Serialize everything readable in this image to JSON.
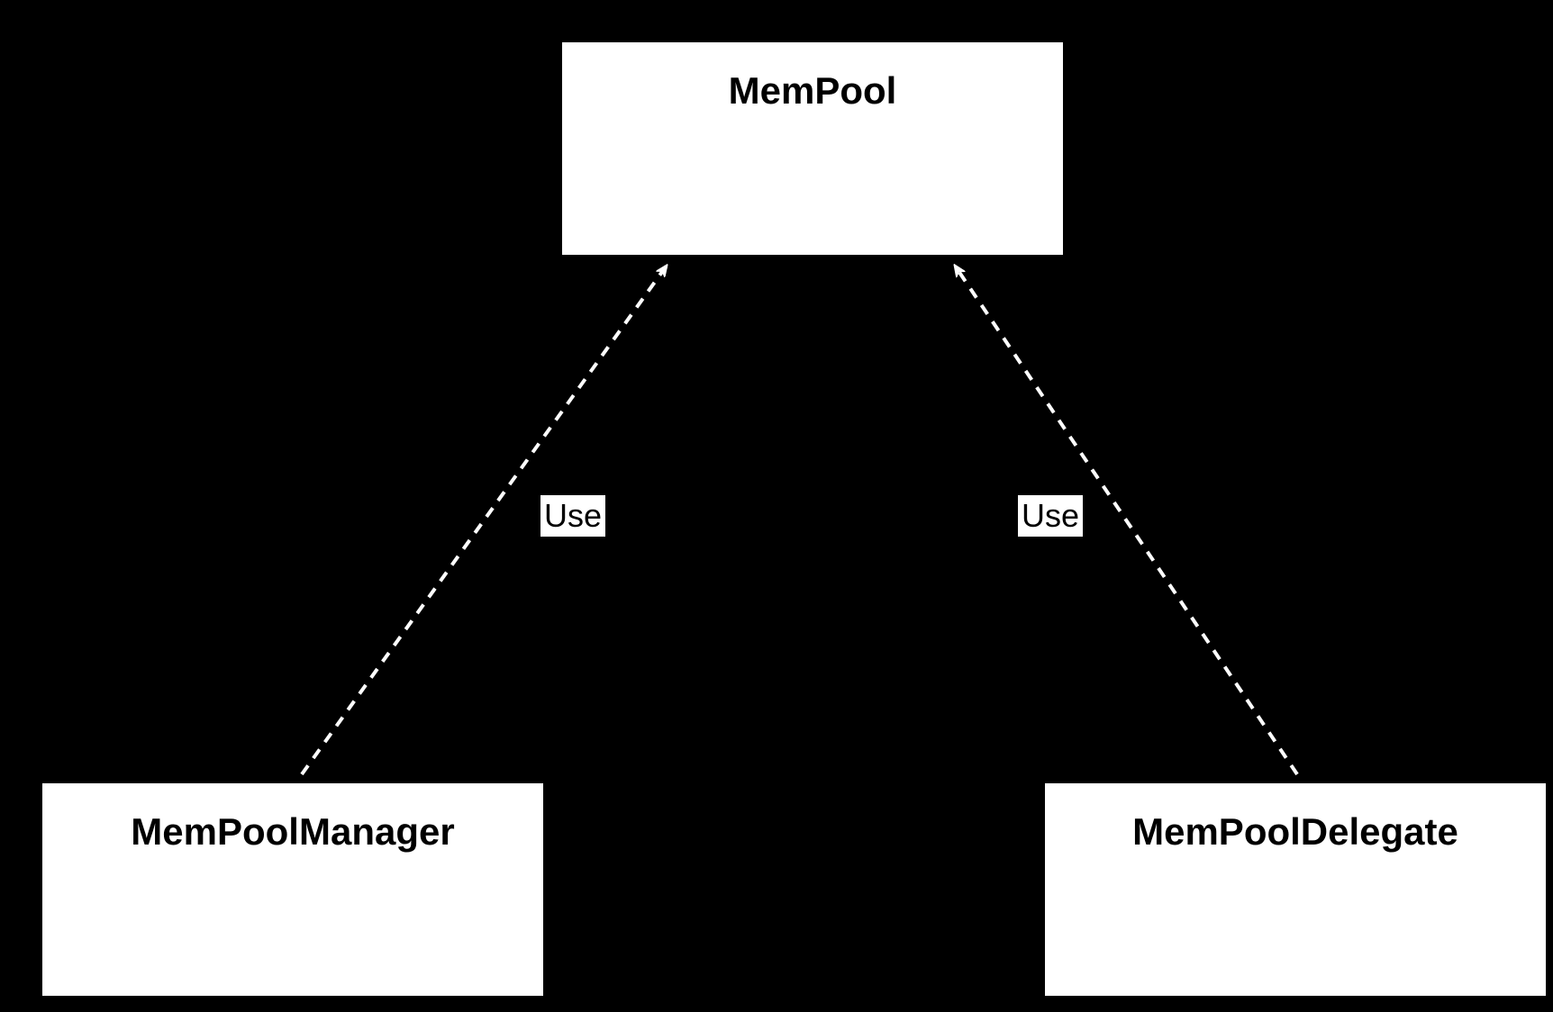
{
  "nodes": {
    "top": {
      "label": "MemPool"
    },
    "bottomLeft": {
      "label": "MemPoolManager"
    },
    "bottomRight": {
      "label": "MemPoolDelegate"
    }
  },
  "edges": {
    "left": {
      "label": "Use"
    },
    "right": {
      "label": "Use"
    }
  }
}
